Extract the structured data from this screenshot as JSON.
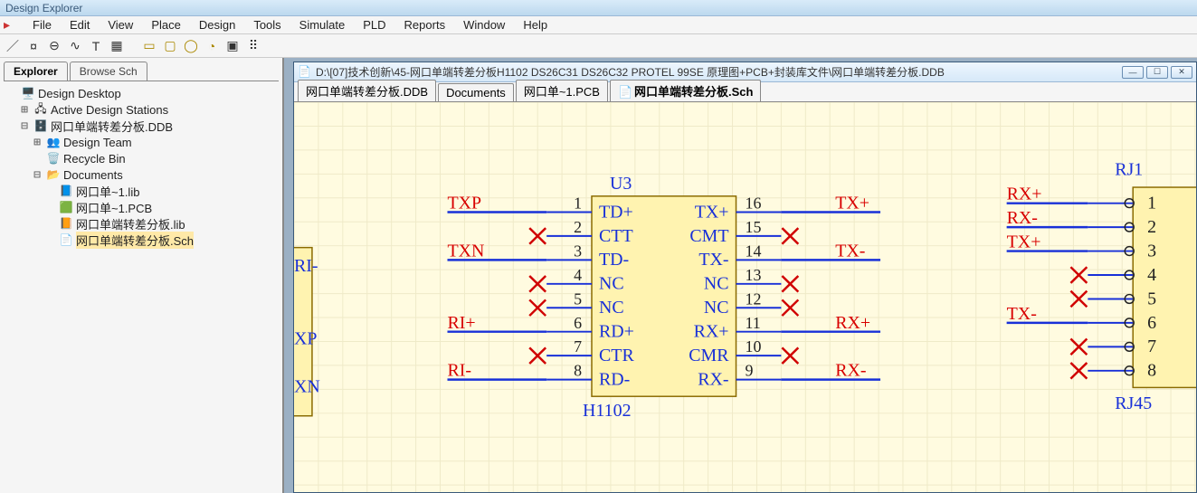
{
  "app_title": "Design Explorer",
  "menu": [
    "File",
    "Edit",
    "View",
    "Place",
    "Design",
    "Tools",
    "Simulate",
    "PLD",
    "Reports",
    "Window",
    "Help"
  ],
  "left_tabs": {
    "explorer": "Explorer",
    "browse": "Browse Sch"
  },
  "tree": {
    "root": "Design Desktop",
    "stations": "Active Design Stations",
    "ddb": "网口单端转差分板.DDB",
    "team": "Design Team",
    "recycle": "Recycle Bin",
    "docs": "Documents",
    "items": [
      "网口单~1.lib",
      "网口单~1.PCB",
      "网口单端转差分板.lib",
      "网口单端转差分板.Sch"
    ]
  },
  "doc_title": "D:\\[07]技术创新\\45-网口单端转差分板H1102 DS26C31 DS26C32 PROTEL 99SE 原理图+PCB+封装库文件\\网口单端转差分板.DDB",
  "doc_tabs": [
    "网口单端转差分板.DDB",
    "Documents",
    "网口单~1.PCB",
    "网口单端转差分板.Sch"
  ],
  "schematic": {
    "u3": {
      "ref": "U3",
      "value": "H1102",
      "left_pins": [
        {
          "num": "1",
          "name": "TD+",
          "net": "TXP",
          "x": false
        },
        {
          "num": "2",
          "name": "CTT",
          "net": "",
          "x": true
        },
        {
          "num": "3",
          "name": "TD-",
          "net": "TXN",
          "x": false
        },
        {
          "num": "4",
          "name": "NC",
          "net": "",
          "x": true
        },
        {
          "num": "5",
          "name": "NC",
          "net": "",
          "x": true
        },
        {
          "num": "6",
          "name": "RD+",
          "net": "RI+",
          "x": false
        },
        {
          "num": "7",
          "name": "CTR",
          "net": "",
          "x": true
        },
        {
          "num": "8",
          "name": "RD-",
          "net": "RI-",
          "x": false
        }
      ],
      "right_pins": [
        {
          "num": "16",
          "name": "TX+",
          "net": "TX+",
          "x": false
        },
        {
          "num": "15",
          "name": "CMT",
          "net": "",
          "x": true
        },
        {
          "num": "14",
          "name": "TX-",
          "net": "TX-",
          "x": false
        },
        {
          "num": "13",
          "name": "NC",
          "net": "",
          "x": true
        },
        {
          "num": "12",
          "name": "NC",
          "net": "",
          "x": true
        },
        {
          "num": "11",
          "name": "RX+",
          "net": "RX+",
          "x": false
        },
        {
          "num": "10",
          "name": "CMR",
          "net": "",
          "x": true
        },
        {
          "num": "9",
          "name": "RX-",
          "net": "RX-",
          "x": false
        }
      ]
    },
    "rj": {
      "ref": "RJ1",
      "value": "RJ45",
      "pins": [
        {
          "num": "1",
          "net": "RX+",
          "x": false
        },
        {
          "num": "2",
          "net": "RX-",
          "x": false
        },
        {
          "num": "3",
          "net": "TX+",
          "x": false
        },
        {
          "num": "4",
          "net": "",
          "x": true
        },
        {
          "num": "5",
          "net": "",
          "x": true
        },
        {
          "num": "6",
          "net": "TX-",
          "x": false
        },
        {
          "num": "7",
          "net": "",
          "x": true
        },
        {
          "num": "8",
          "net": "",
          "x": true
        }
      ]
    },
    "edge_left": {
      "ri_minus": "RI-",
      "xp": "XP",
      "xn": "XN"
    }
  }
}
